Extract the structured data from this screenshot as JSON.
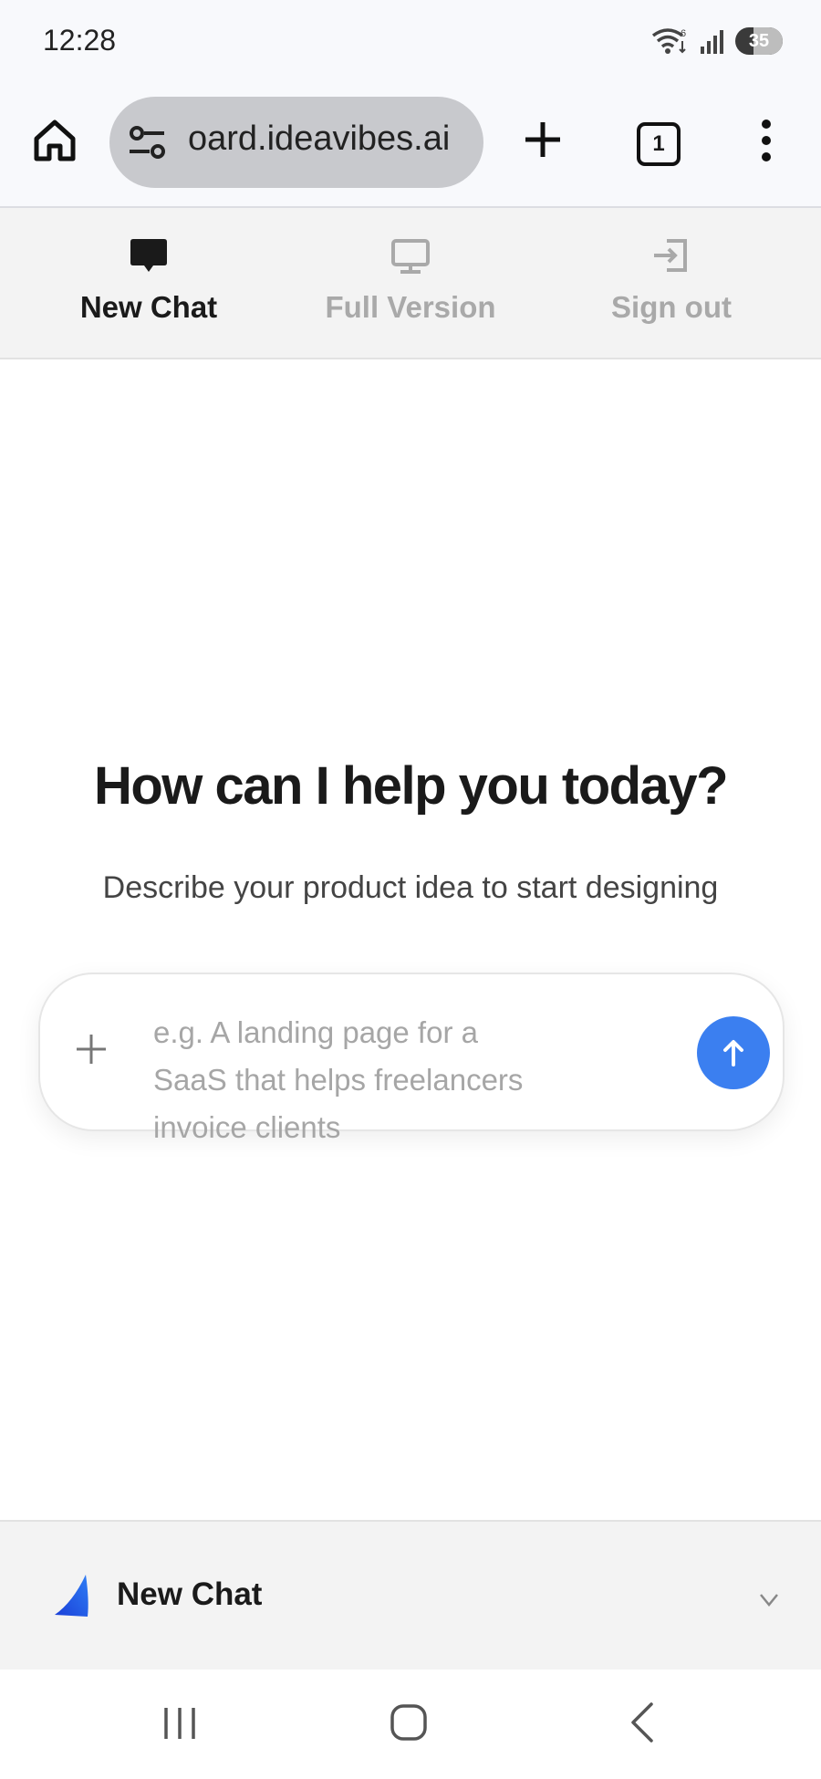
{
  "status_bar": {
    "time": "12:28",
    "battery_level": "35",
    "wifi_badge": "6"
  },
  "browser": {
    "url": "oard.ideavibes.ai",
    "tab_count": "1"
  },
  "app_nav": {
    "items": [
      {
        "label": "New Chat",
        "icon": "chat-bubble-icon",
        "active": true
      },
      {
        "label": "Full Version",
        "icon": "monitor-icon",
        "active": false
      },
      {
        "label": "Sign out",
        "icon": "sign-out-icon",
        "active": false
      }
    ]
  },
  "hero": {
    "title": "How can I help you today?",
    "subtitle": "Describe your product idea to start designing"
  },
  "composer": {
    "placeholder": "e.g. A landing page for a SaaS that helps freelancers invoice clients"
  },
  "chat_bar": {
    "title": "New Chat"
  },
  "colors": {
    "accent": "#3b7ff0",
    "nav_active": "#1a1a1a",
    "nav_inactive": "#a9a9a9"
  }
}
